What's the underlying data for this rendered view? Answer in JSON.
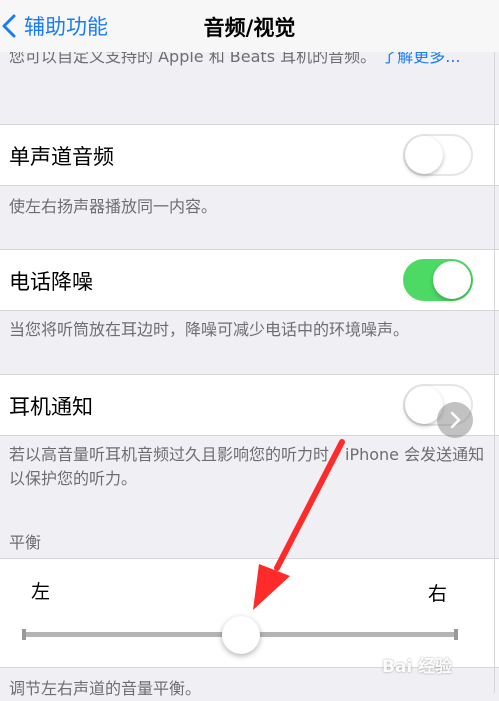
{
  "nav": {
    "back_label": "辅助功能",
    "title": "音频/视觉"
  },
  "top_description": {
    "text": "您可以自定义支持的 Apple 和 Beats 耳机的音频。",
    "link": "了解更多..."
  },
  "rows": [
    {
      "label": "单声道音频",
      "toggle_on": false,
      "footer": "使左右扬声器播放同一内容。"
    },
    {
      "label": "电话降噪",
      "toggle_on": true,
      "footer": "当您将听筒放在耳边时，降噪可减少电话中的环境噪声。"
    },
    {
      "label": "耳机通知",
      "toggle_on": false,
      "footer": "若以高音量听耳机音频过久且影响您的听力时，iPhone 会发送通知以保护您的听力。"
    }
  ],
  "balance": {
    "section_header": "平衡",
    "left_label": "左",
    "right_label": "右",
    "value": 0.5,
    "footer": "调节左右声道的音量平衡。"
  },
  "watermark": "Bai 经验",
  "colors": {
    "accent": "#1a7cf5",
    "toggle_on": "#4cd964",
    "annotation_arrow": "#ff2a2a"
  },
  "icons": {
    "back": "chevron-left-icon",
    "overlay": "chevron-right-icon"
  }
}
